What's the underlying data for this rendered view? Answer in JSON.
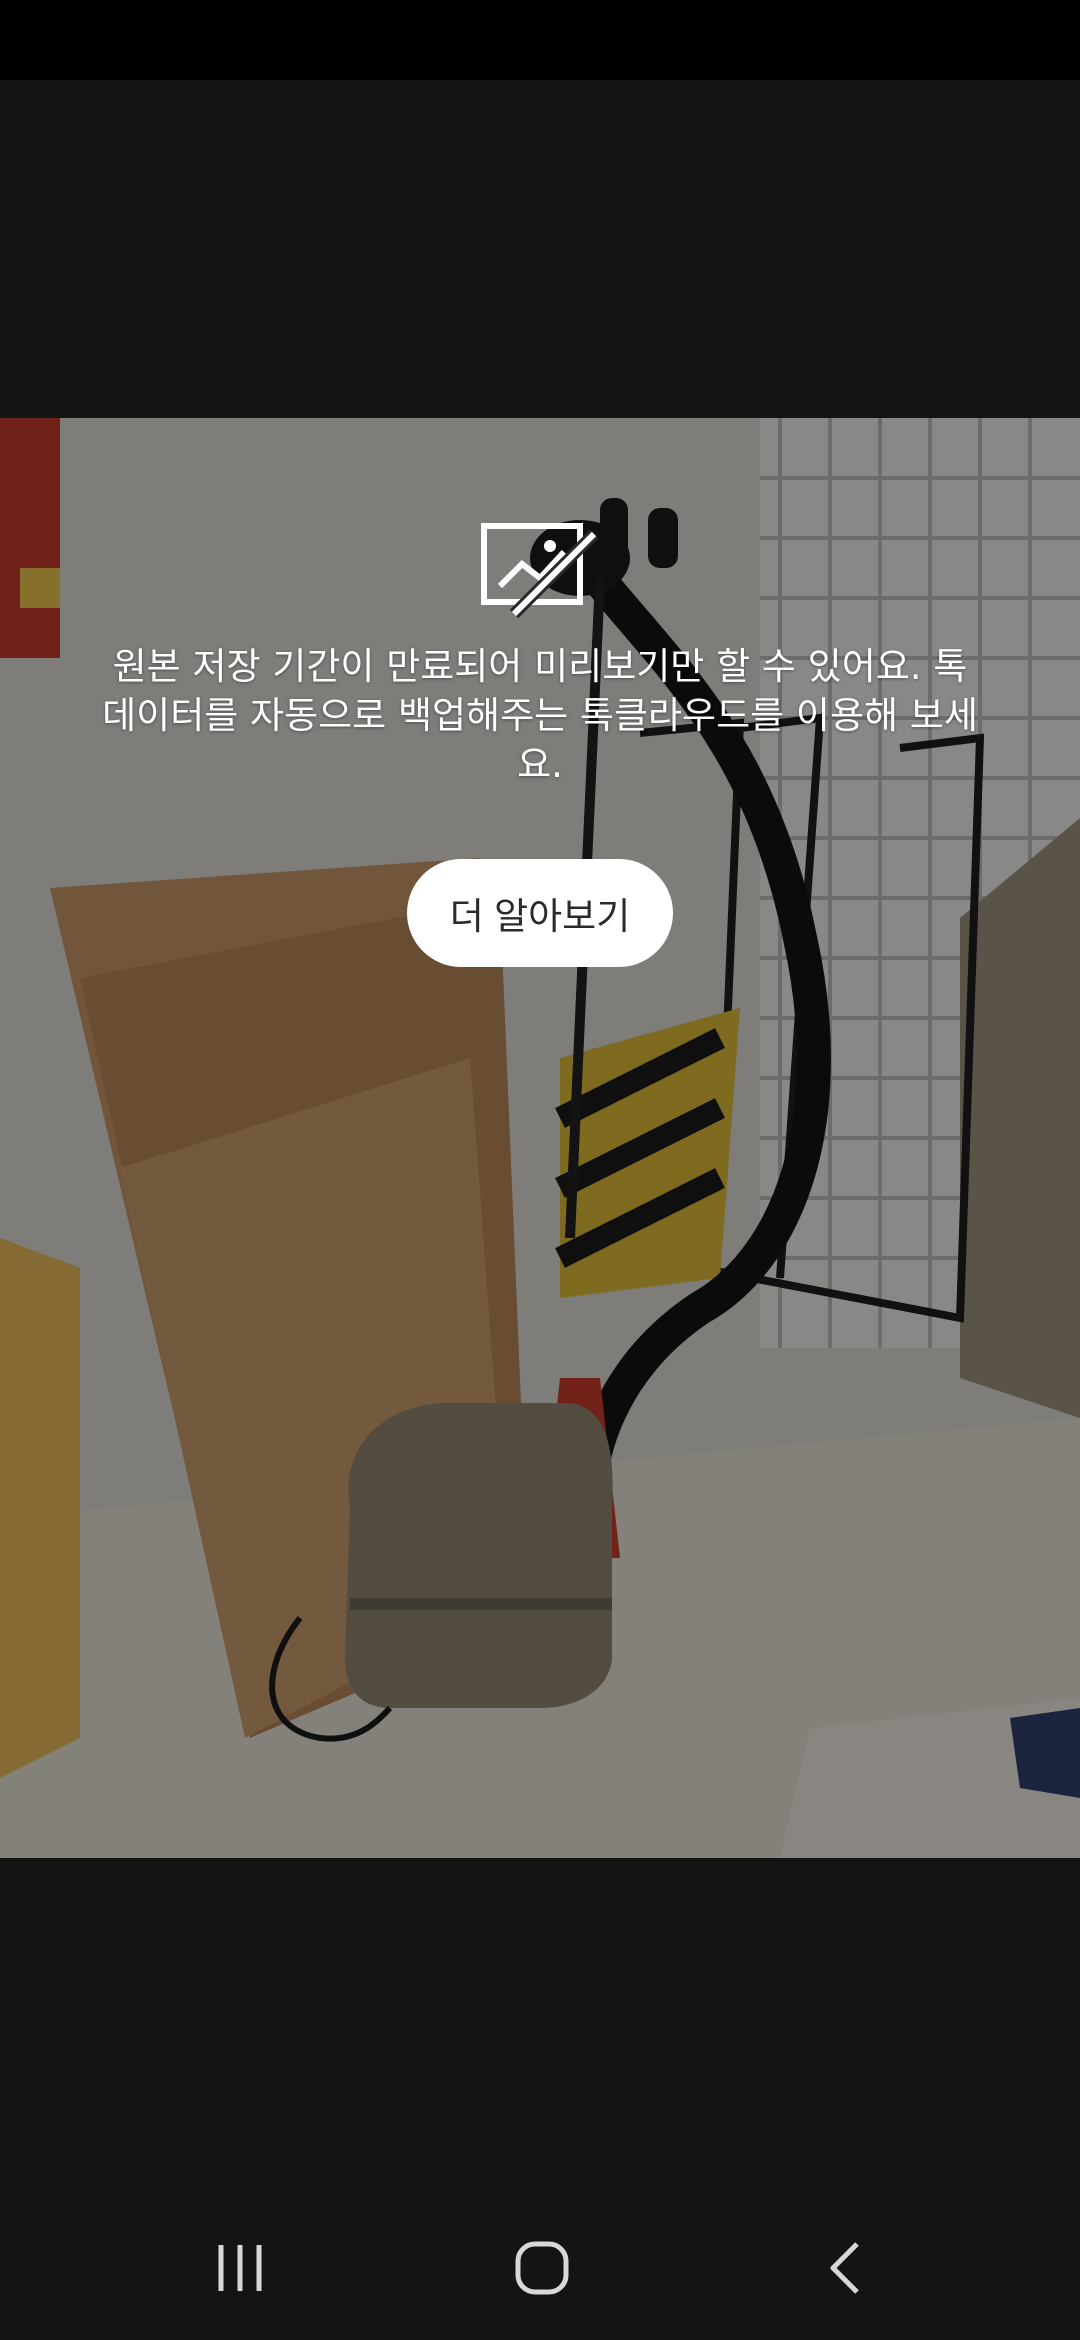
{
  "notice": {
    "icon": "image-expired-icon",
    "message": "원본 저장 기간이 만료되어 미리보기만 할 수 있어요. 톡 데이터를 자동으로 백업해주는 톡클라우드를 이용해 보세요.",
    "button_label": "더 알아보기"
  },
  "nav": {
    "recents_icon": "recent-apps-icon",
    "home_icon": "home-icon",
    "back_icon": "back-icon"
  },
  "colors": {
    "background": "#141414",
    "button_bg": "#ffffff",
    "text": "#ffffff"
  }
}
